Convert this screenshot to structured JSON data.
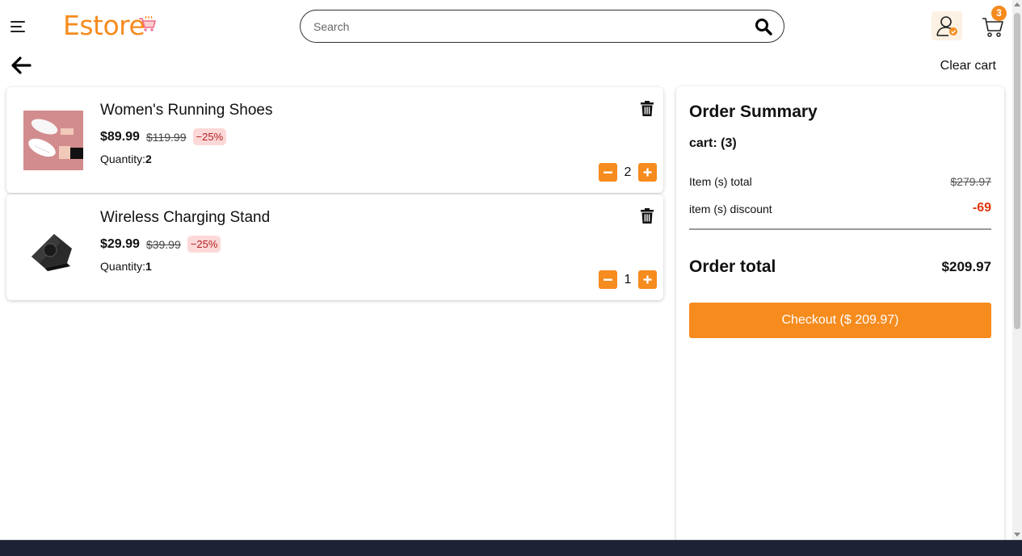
{
  "header": {
    "logo_text": "Estore",
    "search_placeholder": "Search",
    "cart_count": "3"
  },
  "toolbar": {
    "clear_cart_label": "Clear cart"
  },
  "cart_items": [
    {
      "name": "Women's Running Shoes",
      "price": "$89.99",
      "old_price": "$119.99",
      "discount": "−25%",
      "quantity_label": "Quantity:",
      "quantity": "2",
      "image": "running-shoes-photo"
    },
    {
      "name": "Wireless Charging Stand",
      "price": "$29.99",
      "old_price": "$39.99",
      "discount": "−25%",
      "quantity_label": "Quantity:",
      "quantity": "1",
      "image": "charging-stand-photo"
    }
  ],
  "summary": {
    "title": "Order Summary",
    "cart_count_label": "cart: (3)",
    "items_total_label": "Item (s) total",
    "items_total_value": "$279.97",
    "discount_label": "item (s) discount",
    "discount_value": "-69",
    "order_total_label": "Order total",
    "order_total_value": "$209.97",
    "checkout_label": "Checkout ($ 209.97)"
  },
  "colors": {
    "accent": "#f68b1e",
    "discount_red": "#e0360f",
    "badge_bg": "#fdd8d8"
  },
  "icons": [
    "menu-icon",
    "cart-logo-icon",
    "search-icon",
    "account-icon",
    "cart-icon",
    "back-arrow-icon",
    "trash-icon",
    "minus-icon",
    "plus-icon"
  ]
}
